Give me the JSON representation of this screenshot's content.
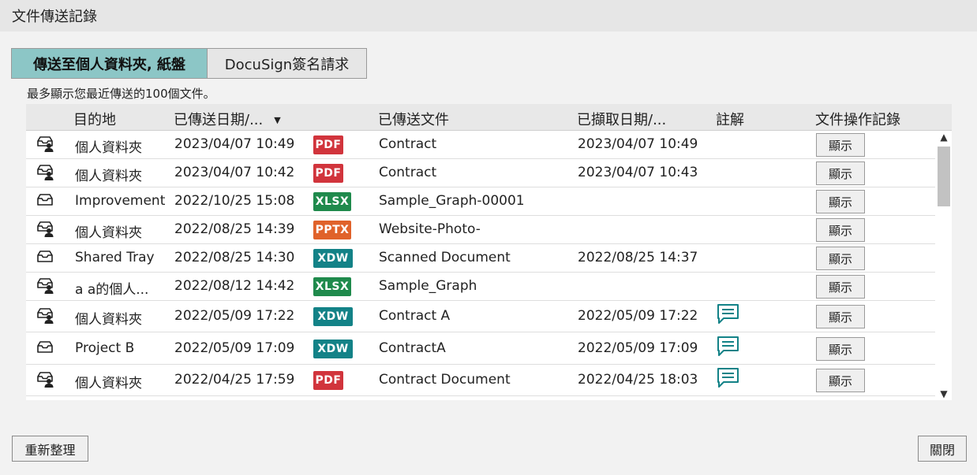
{
  "window": {
    "title": "文件傳送記錄"
  },
  "tabs": [
    {
      "label": "傳送至個人資料夾, 紙盤",
      "active": true
    },
    {
      "label": "DocuSign簽名請求",
      "active": false
    }
  ],
  "note": "最多顯示您最近傳送的100個文件。",
  "table": {
    "headers": {
      "destination": "目的地",
      "sent_date": "已傳送日期/...",
      "sent_file": "已傳送文件",
      "retrieved_date": "已擷取日期/...",
      "comment": "註解",
      "log": "文件操作記錄"
    },
    "sort_indicator": "▼",
    "rows": [
      {
        "dest_icon": "personal-folder-icon",
        "destination": "個人資料夾",
        "sent_date": "2023/04/07 10:49",
        "type": "PDF",
        "file": "Contract",
        "retrieved_date": "2023/04/07 10:49",
        "has_comment": false,
        "show_label": "顯示"
      },
      {
        "dest_icon": "personal-folder-icon",
        "destination": "個人資料夾",
        "sent_date": "2023/04/07 10:42",
        "type": "PDF",
        "file": "Contract",
        "retrieved_date": "2023/04/07 10:43",
        "has_comment": false,
        "show_label": "顯示"
      },
      {
        "dest_icon": "tray-icon",
        "destination": "Improvement",
        "sent_date": "2022/10/25 15:08",
        "type": "XLSX",
        "file": "Sample_Graph-00001",
        "retrieved_date": "",
        "has_comment": false,
        "show_label": "顯示"
      },
      {
        "dest_icon": "personal-folder-icon",
        "destination": "個人資料夾",
        "sent_date": "2022/08/25 14:39",
        "type": "PPTX",
        "file": "Website-Photo-",
        "retrieved_date": "",
        "has_comment": false,
        "show_label": "顯示"
      },
      {
        "dest_icon": "tray-icon",
        "destination": "Shared Tray",
        "sent_date": "2022/08/25 14:30",
        "type": "XDW",
        "file": "Scanned Document",
        "retrieved_date": "2022/08/25 14:37",
        "has_comment": false,
        "show_label": "顯示"
      },
      {
        "dest_icon": "personal-folder-icon",
        "destination": "a a的個人...",
        "sent_date": "2022/08/12 14:42",
        "type": "XLSX",
        "file": "Sample_Graph",
        "retrieved_date": "",
        "has_comment": false,
        "show_label": "顯示"
      },
      {
        "dest_icon": "personal-folder-icon",
        "destination": "個人資料夾",
        "sent_date": "2022/05/09 17:22",
        "type": "XDW",
        "file": "Contract A",
        "retrieved_date": "2022/05/09 17:22",
        "has_comment": true,
        "show_label": "顯示"
      },
      {
        "dest_icon": "tray-icon",
        "destination": "Project B",
        "sent_date": "2022/05/09 17:09",
        "type": "XDW",
        "file": "ContractA",
        "retrieved_date": "2022/05/09 17:09",
        "has_comment": true,
        "show_label": "顯示"
      },
      {
        "dest_icon": "personal-folder-icon",
        "destination": "個人資料夾",
        "sent_date": "2022/04/25 17:59",
        "type": "PDF",
        "file": "Contract Document",
        "retrieved_date": "2022/04/25 18:03",
        "has_comment": true,
        "show_label": "顯示"
      },
      {
        "dest_icon": "personal-folder-icon",
        "destination": "",
        "sent_date": "",
        "type": "",
        "file": "",
        "retrieved_date": "",
        "has_comment": true,
        "show_label": ""
      }
    ]
  },
  "badge_colors": {
    "PDF": "#d1343c",
    "XLSX": "#1f8a4c",
    "PPTX": "#e0622a",
    "XDW": "#138287"
  },
  "accent_color": "#8cc6c6",
  "comment_icon_color": "#138287",
  "buttons": {
    "refresh": "重新整理",
    "close": "關閉"
  }
}
